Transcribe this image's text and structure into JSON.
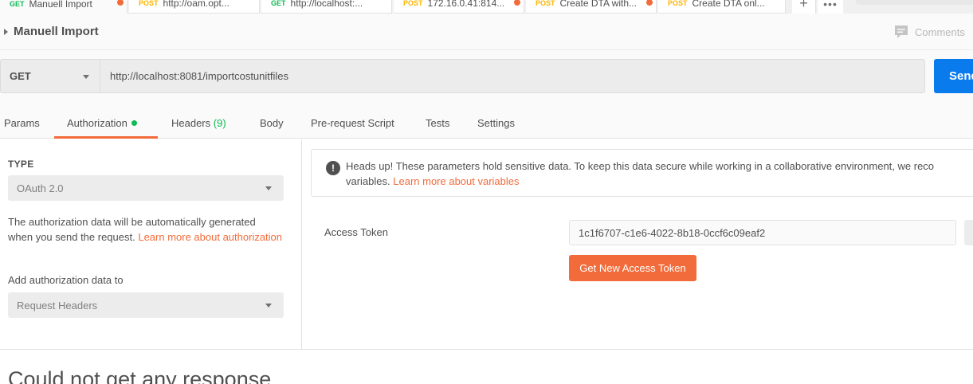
{
  "tabs": [
    {
      "method": "GET",
      "label": "Manuell Import",
      "unsaved": true,
      "active": true
    },
    {
      "method": "POST",
      "label": "http://oam.opt...",
      "unsaved": false,
      "active": false
    },
    {
      "method": "GET",
      "label": "http://localhost:...",
      "unsaved": false,
      "active": false
    },
    {
      "method": "POST",
      "label": "172.16.0.41:814...",
      "unsaved": true,
      "active": false
    },
    {
      "method": "POST",
      "label": "Create DTA with...",
      "unsaved": true,
      "active": false
    },
    {
      "method": "POST",
      "label": "Create DTA onl...",
      "unsaved": false,
      "active": false
    }
  ],
  "tab_controls": {
    "add_label": "+",
    "more_label": "•••"
  },
  "request": {
    "name": "Manuell Import",
    "comments_label": "Comments",
    "method": "GET",
    "url": "http://localhost:8081/importcostunitfiles",
    "send_label": "Send"
  },
  "subtabs": {
    "params": "Params",
    "authorization": "Authorization",
    "headers": "Headers",
    "headers_count": "(9)",
    "body": "Body",
    "prerequest": "Pre-request Script",
    "tests": "Tests",
    "settings": "Settings"
  },
  "auth": {
    "type_label": "TYPE",
    "type_value": "OAuth 2.0",
    "description": "The authorization data will be automatically generated when you send the request. ",
    "description_link": "Learn more about authorization",
    "add_to_label": "Add authorization data to",
    "add_to_value": "Request Headers",
    "warning_line1": "Heads up! These parameters hold sensitive data. To keep this data secure while working in a collaborative environment, we reco",
    "warning_line2_prefix": "variables. ",
    "warning_link": "Learn more about variables",
    "access_token_label": "Access Token",
    "access_token_value": "1c1f6707-c1e6-4022-8b18-0ccf6c09eaf2",
    "get_token_label": "Get New Access Token"
  },
  "response": {
    "message": "Could not get any response"
  },
  "colors": {
    "accent": "#f26b3a",
    "get": "#0cbb52",
    "post": "#ffb400",
    "send": "#097bed"
  }
}
